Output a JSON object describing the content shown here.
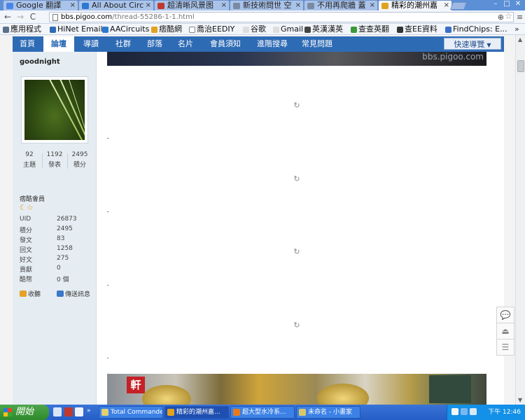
{
  "browser": {
    "tabs": [
      {
        "title": "Google 翻譯",
        "color": "#4a86e8"
      },
      {
        "title": "All About Circuits",
        "color": "#2b79d0"
      },
      {
        "title": "超清晰风景图",
        "color": "#c0392b"
      },
      {
        "title": "新技術問世 空",
        "color": "#7a8aa3"
      },
      {
        "title": "不用再爬牆 蓋",
        "color": "#7a8aa3"
      },
      {
        "title": "精彩的潮州嘉",
        "color": "#e1a21e"
      }
    ],
    "window_controls": [
      "–",
      "□",
      "✕"
    ],
    "address": {
      "host": "bbs.pigoo.com",
      "path": "/thread-55286-1-1.html"
    },
    "nav": {
      "back": "←",
      "forward": "→",
      "reload": "C",
      "zoom": "⊕",
      "star": "☆",
      "wrench": "≡"
    },
    "bookmarks": [
      {
        "label": "應用程式",
        "color": "#5c6f8c"
      },
      {
        "label": "HiNet Email",
        "color": "#2e6bb5"
      },
      {
        "label": "AACircuits",
        "color": "#2b79d0"
      },
      {
        "label": "痞酷網",
        "color": "#e1a21e"
      },
      {
        "label": "喬治EEDIY",
        "color": "#dddddd"
      },
      {
        "label": "谷歌",
        "color": "#888888"
      },
      {
        "label": "Gmail",
        "color": "#888888"
      },
      {
        "label": "英漢漢英",
        "color": "#444444"
      },
      {
        "label": "查查英翻",
        "color": "#3a9a3a"
      },
      {
        "label": "查EE資料",
        "color": "#333333"
      },
      {
        "label": "FindChips: E...",
        "color": "#3a6fc4"
      }
    ],
    "bookmarks_more": "»"
  },
  "site": {
    "nav": [
      "首頁",
      "論壇",
      "導讀",
      "社群",
      "部落",
      "名片",
      "會員須知",
      "進階搜尋",
      "常見問題"
    ],
    "active_nav": "論壇",
    "quick_nav": "快速導覽",
    "watermark": "bbs.pigoo.com"
  },
  "profile": {
    "username": "goodnight",
    "stats": [
      {
        "value": "92",
        "label": "主題"
      },
      {
        "value": "1192",
        "label": "發表"
      },
      {
        "value": "2495",
        "label": "積分"
      }
    ],
    "group": "痞酷會員",
    "medals": "☾☆",
    "info": [
      {
        "k": "UID",
        "v": "26873"
      },
      {
        "k": "積分",
        "v": "2495"
      },
      {
        "k": "發文",
        "v": "83"
      },
      {
        "k": "回文",
        "v": "1258"
      },
      {
        "k": "好文",
        "v": "275"
      },
      {
        "k": "貢獻",
        "v": "0"
      },
      {
        "k": "酷幣",
        "v": "0 個"
      }
    ],
    "actions": [
      {
        "label": "收聽",
        "color": "#e7a126"
      },
      {
        "label": "傳送訊息",
        "color": "#3a78c9"
      }
    ]
  },
  "content": {
    "loader_glyph": "↻",
    "bottom_sign": "軒"
  },
  "float_tools": [
    "💬",
    "⏏",
    "☰"
  ],
  "taskbar": {
    "start": "開始",
    "buttons": [
      {
        "label": "Total Commande...",
        "color": "#e0d070"
      },
      {
        "label": "精彩的潮州嘉...",
        "color": "#e1a21e"
      },
      {
        "label": "超大型水冷系...",
        "color": "#e57a1e"
      },
      {
        "label": "未命名 - 小畫家",
        "color": "#d9c86a"
      }
    ],
    "clock": "下午 12:46",
    "watermark": "bbs.pigoo.com"
  }
}
